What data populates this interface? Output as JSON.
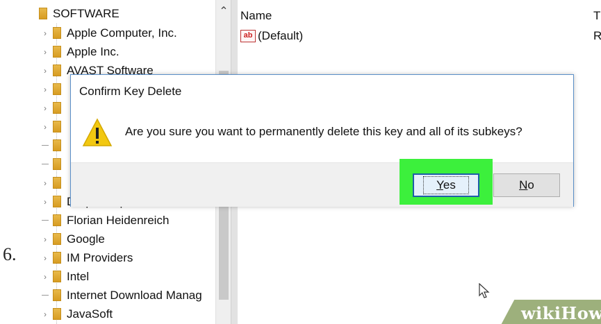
{
  "step": "6.",
  "tree": {
    "root": "SOFTWARE",
    "items": [
      {
        "label": "Apple Computer, Inc.",
        "kind": "chevron"
      },
      {
        "label": "Apple Inc.",
        "kind": "chevron"
      },
      {
        "label": "AVAST Software",
        "kind": "chevron"
      },
      {
        "label": "",
        "kind": "chevron"
      },
      {
        "label": "",
        "kind": "chevron"
      },
      {
        "label": "",
        "kind": "chevron"
      },
      {
        "label": "",
        "kind": "dash"
      },
      {
        "label": "",
        "kind": "dash"
      },
      {
        "label": "",
        "kind": "chevron"
      },
      {
        "label": "DropboxUpdate",
        "kind": "chevron"
      },
      {
        "label": "Florian Heidenreich",
        "kind": "dash"
      },
      {
        "label": "Google",
        "kind": "chevron"
      },
      {
        "label": "IM Providers",
        "kind": "chevron"
      },
      {
        "label": "Intel",
        "kind": "chevron"
      },
      {
        "label": "Internet Download Manag",
        "kind": "dash"
      },
      {
        "label": "JavaSoft",
        "kind": "chevron"
      }
    ]
  },
  "values_pane": {
    "columns": [
      "Name",
      "T"
    ],
    "rows": [
      {
        "name": "(Default)",
        "type": "R",
        "icon": "ab-icon"
      }
    ]
  },
  "dialog": {
    "title": "Confirm Key Delete",
    "message": "Are you sure you want to permanently delete this key and all of its subkeys?",
    "icon": "warning-icon",
    "yes_label": "Yes",
    "no_label": "No",
    "yes_underline": "Y",
    "yes_rest": "es",
    "no_underline": "N",
    "no_rest": "o"
  },
  "watermark": {
    "text": "wikiHow"
  },
  "colors": {
    "highlight": "#3cf03c",
    "accent": "#1d5ea8"
  }
}
